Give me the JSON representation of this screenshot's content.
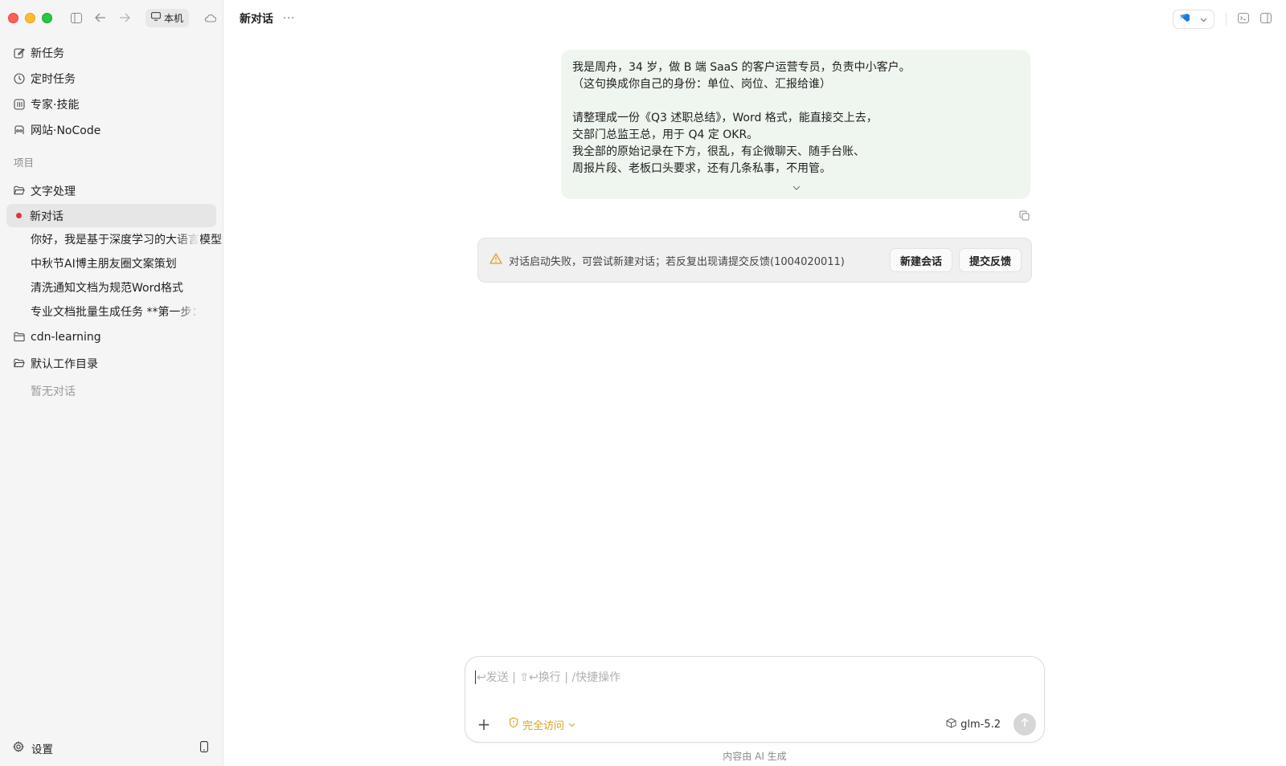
{
  "titlebar": {
    "location_label": "本机"
  },
  "sidebar": {
    "nav": [
      {
        "label": "新任务",
        "icon": "edit-icon"
      },
      {
        "label": "定时任务",
        "icon": "clock-icon"
      },
      {
        "label": "专家·技能",
        "icon": "skills-icon"
      },
      {
        "label": "网站·NoCode",
        "icon": "nocode-icon"
      }
    ],
    "section_label": "项目",
    "folders": {
      "text_processing": "文字处理",
      "cdn": "cdn-learning",
      "default_dir": "默认工作目录"
    },
    "active_conversation": "新对话",
    "conversations": [
      "你好，我是基于深度学习的大语言模型",
      "中秋节AI博主朋友圈文案策划",
      "清洗通知文档为规范Word格式",
      "专业文档批量生成任务 **第一步："
    ],
    "empty_label": "暂无对话",
    "settings_label": "设置"
  },
  "header": {
    "title": "新对话",
    "more": "···"
  },
  "message": {
    "lines": [
      "我是周舟，34 岁，做 B 端 SaaS 的客户运营专员，负责中小客户。",
      "（这句换成你自己的身份：单位、岗位、汇报给谁）",
      "",
      "请整理成一份《Q3 述职总结》，Word 格式，能直接交上去，",
      "交部门总监王总，用于 Q4 定 OKR。",
      "我全部的原始记录在下方，很乱，有企微聊天、随手台账、",
      "周报片段、老板口头要求，还有几条私事，不用管。"
    ]
  },
  "error": {
    "text": "对话启动失败，可尝试新建对话；若反复出现请提交反馈(1004020011)",
    "new_session": "新建会话",
    "feedback": "提交反馈"
  },
  "composer": {
    "placeholder": "↩发送 | ⇧↩换行 | /快捷操作",
    "access_label": "完全访问",
    "model": "glm-5.2"
  },
  "footer_note": "内容由 AI 生成",
  "colors": {
    "accent_warning": "#e0a020",
    "bubble_bg": "#eff6ef",
    "active_dot": "#e5323a",
    "vscode_blue": "#1f7bd6"
  }
}
